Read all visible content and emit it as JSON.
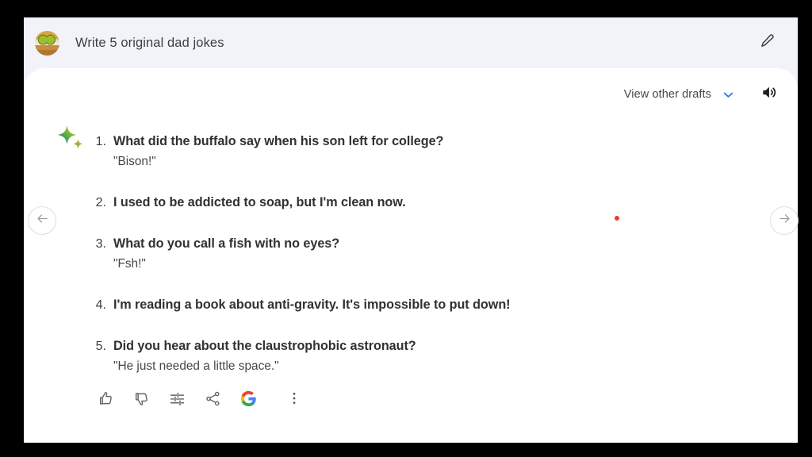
{
  "window": {
    "background_color": "#000000",
    "card_background": "#f1f3f9",
    "panel_background": "#ffffff"
  },
  "header": {
    "avatar_icon": "burger-avatar-image",
    "prompt_text": "Write 5 original dad jokes",
    "edit_icon": "pencil-edit-icon"
  },
  "drafts": {
    "label": "View other drafts",
    "chevron_icon": "chevron-down-icon",
    "chevron_color": "#3a7bea",
    "speaker_icon": "speaker-volume-icon"
  },
  "response": {
    "logo_icon": "bard-sparkle-icon",
    "jokes": [
      {
        "number": "1.",
        "setup": "What did the buffalo say when his son left for college?",
        "punchline": "\"Bison!\""
      },
      {
        "number": "2.",
        "setup": "I used to be addicted to soap, but I'm clean now.",
        "punchline": ""
      },
      {
        "number": "3.",
        "setup": "What do you call a fish with no eyes?",
        "punchline": "\"Fsh!\""
      },
      {
        "number": "4.",
        "setup": "I'm reading a book about anti-gravity. It's impossible to put down!",
        "punchline": ""
      },
      {
        "number": "5.",
        "setup": "Did you hear about the claustrophobic astronaut?",
        "punchline": "\"He just needed a little space.\""
      }
    ]
  },
  "actions": [
    {
      "name": "thumb-up-icon",
      "label": "Good response"
    },
    {
      "name": "thumb-down-icon",
      "label": "Bad response"
    },
    {
      "name": "tune-icon",
      "label": "Modify response"
    },
    {
      "name": "share-icon",
      "label": "Share & export"
    },
    {
      "name": "google-logo-icon",
      "label": "Google it"
    },
    {
      "name": "more-vert-icon",
      "label": "More"
    }
  ],
  "navigation": {
    "prev_icon": "arrow-left-icon",
    "next_icon": "arrow-right-icon"
  },
  "cursor": {
    "dot_color": "#ef3e25"
  }
}
